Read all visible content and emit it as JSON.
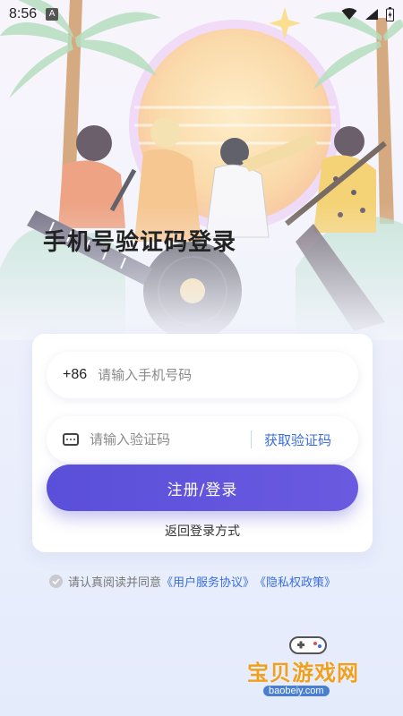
{
  "status_bar": {
    "time": "8:56",
    "notification_badge": "A"
  },
  "page_title": "手机号验证码登录",
  "login_form": {
    "phone_prefix": "+86",
    "phone_placeholder": "请输入手机号码",
    "code_placeholder": "请输入验证码",
    "get_code_label": "获取验证码",
    "submit_label": "注册/登录",
    "back_link": "返回登录方式"
  },
  "agreement": {
    "prefix_text": "请认真阅读并同意",
    "user_agreement": "《用户服务协议》",
    "privacy_policy": "《隐私权政策》"
  },
  "watermark": {
    "text": "宝贝游戏网",
    "url": "baobeiy.com"
  },
  "colors": {
    "accent": "#5a4fd9",
    "link": "#3a6ee0",
    "background": "#eef0fb"
  }
}
